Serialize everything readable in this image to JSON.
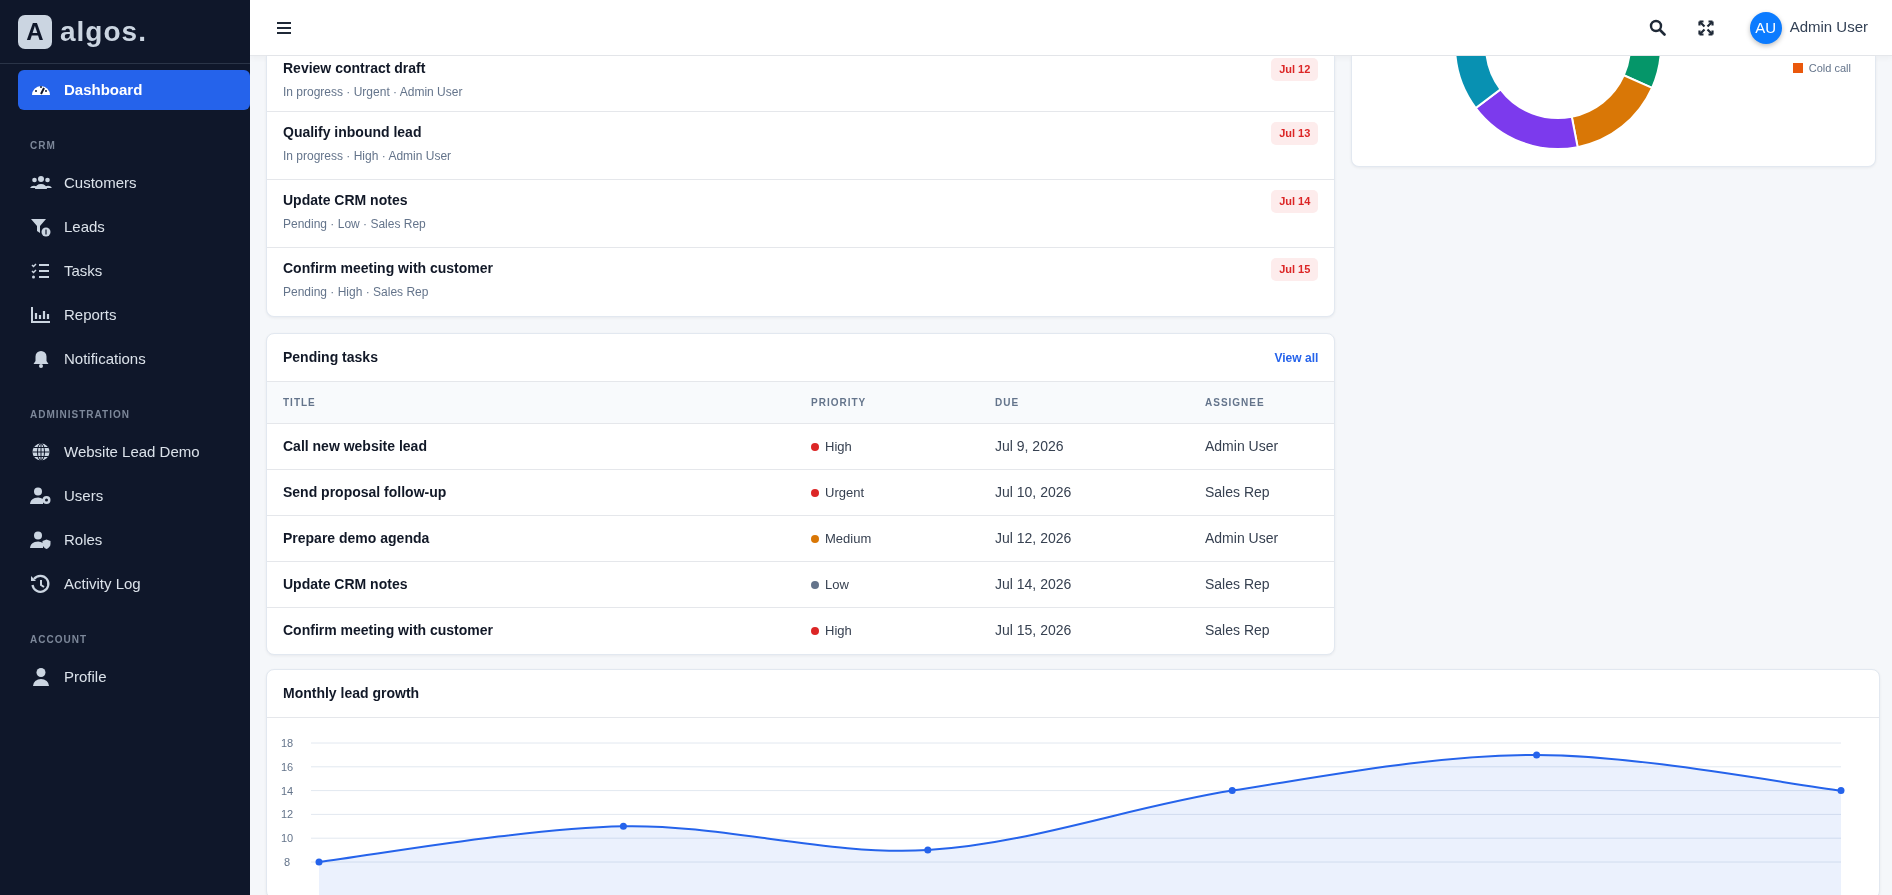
{
  "sidebar": {
    "logo_mark": "A",
    "logo_text": "algos.",
    "sections": [
      {
        "items": [
          {
            "label": "Dashboard",
            "selected": true
          }
        ]
      },
      {
        "heading": "CRM",
        "items": [
          {
            "label": "Customers",
            "selected": false
          },
          {
            "label": "Leads",
            "selected": false
          },
          {
            "label": "Tasks",
            "selected": false
          },
          {
            "label": "Reports",
            "selected": false
          },
          {
            "label": "Notifications",
            "selected": false
          }
        ]
      },
      {
        "heading": "ADMINISTRATION",
        "items": [
          {
            "label": "Website Lead Demo",
            "selected": false
          },
          {
            "label": "Users",
            "selected": false
          },
          {
            "label": "Roles",
            "selected": false
          },
          {
            "label": "Activity Log",
            "selected": false
          }
        ]
      },
      {
        "heading": "ACCOUNT",
        "items": [
          {
            "label": "Profile",
            "selected": false
          }
        ]
      }
    ]
  },
  "topbar": {
    "avatar_initials": "AU",
    "user_name": "Admin User"
  },
  "task_list": {
    "items": [
      {
        "title": "Review contract draft",
        "meta": "In progress · Urgent · Admin User",
        "due": "Jul 12"
      },
      {
        "title": "Qualify inbound lead",
        "meta": "In progress · High · Admin User",
        "due": "Jul 13"
      },
      {
        "title": "Update CRM notes",
        "meta": "Pending · Low · Sales Rep",
        "due": "Jul 14"
      },
      {
        "title": "Confirm meeting with customer",
        "meta": "Pending · High · Sales Rep",
        "due": "Jul 15"
      }
    ]
  },
  "lead_sources": {
    "legend": [
      {
        "label": "Cold call",
        "color": "#ea580c"
      }
    ]
  },
  "pending_tasks": {
    "title": "Pending tasks",
    "view_all": "View all",
    "columns": [
      "TITLE",
      "PRIORITY",
      "DUE",
      "ASSIGNEE"
    ],
    "rows": [
      {
        "title": "Call new website lead",
        "priority": "High",
        "color": "#dc2626",
        "due": "Jul 9, 2026",
        "assignee": "Admin User"
      },
      {
        "title": "Send proposal follow-up",
        "priority": "Urgent",
        "color": "#dc2626",
        "due": "Jul 10, 2026",
        "assignee": "Sales Rep"
      },
      {
        "title": "Prepare demo agenda",
        "priority": "Medium",
        "color": "#d97706",
        "due": "Jul 12, 2026",
        "assignee": "Admin User"
      },
      {
        "title": "Update CRM notes",
        "priority": "Low",
        "color": "#64748b",
        "due": "Jul 14, 2026",
        "assignee": "Sales Rep"
      },
      {
        "title": "Confirm meeting with customer",
        "priority": "High",
        "color": "#dc2626",
        "due": "Jul 15, 2026",
        "assignee": "Sales Rep"
      }
    ]
  },
  "lead_growth": {
    "title": "Monthly lead growth",
    "chart_data": {
      "type": "area",
      "values": [
        8,
        11,
        9,
        14,
        17,
        14
      ],
      "ylim": [
        8,
        18
      ],
      "grid": true,
      "yticks": [
        8,
        10,
        12,
        14,
        16,
        18
      ]
    }
  }
}
